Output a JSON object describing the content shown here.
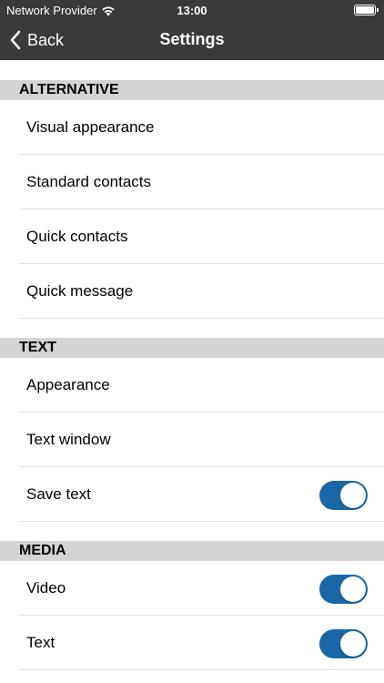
{
  "status_bar": {
    "carrier": "Network Provider",
    "time": "13:00"
  },
  "nav": {
    "back_label": "Back",
    "title": "Settings"
  },
  "sections": [
    {
      "header": "ALTERNATIVE",
      "rows": [
        {
          "label": "Visual appearance"
        },
        {
          "label": "Standard contacts"
        },
        {
          "label": "Quick contacts"
        },
        {
          "label": "Quick message"
        }
      ]
    },
    {
      "header": "TEXT",
      "rows": [
        {
          "label": "Appearance"
        },
        {
          "label": "Text window"
        },
        {
          "label": "Save text",
          "toggle": true
        }
      ]
    },
    {
      "header": "MEDIA",
      "rows": [
        {
          "label": "Video",
          "toggle": true
        },
        {
          "label": "Text",
          "toggle": true
        }
      ]
    }
  ],
  "colors": {
    "toggle_on": "#1a67a8",
    "nav_bg": "#3a3a3a",
    "section_bg": "#d4d4d4"
  }
}
